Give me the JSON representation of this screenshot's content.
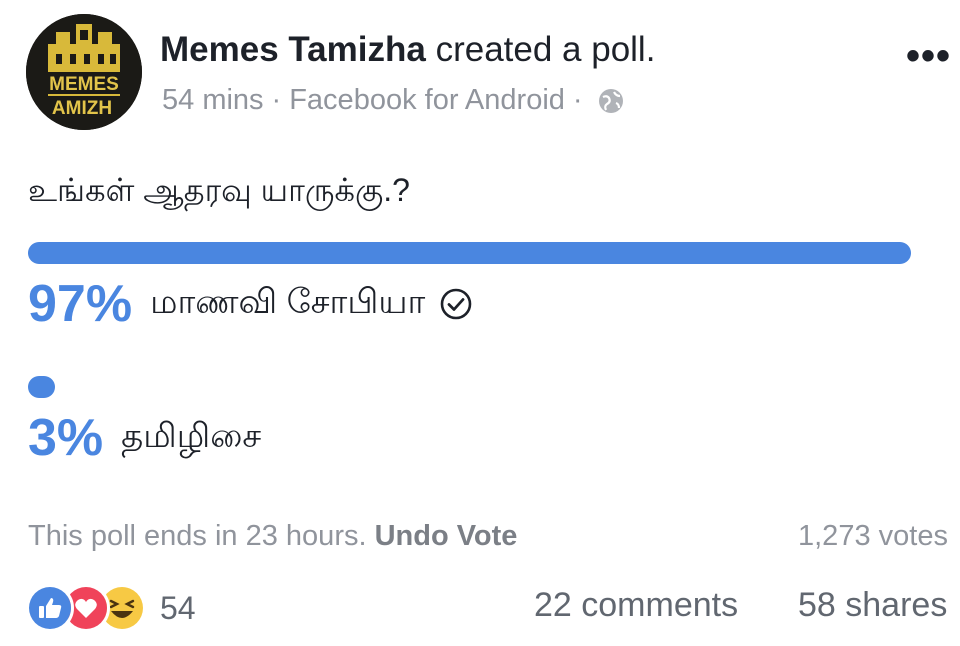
{
  "post": {
    "author": "Memes Tamizha",
    "action": " created a poll.",
    "time": "54 mins",
    "sep1": "·",
    "source": "Facebook for Android",
    "sep2": "·",
    "privacy_icon": "globe-icon",
    "more_icon": "more-options-icon",
    "avatar_text_top": "MEMES",
    "avatar_text_bottom": "AMIZH"
  },
  "poll": {
    "question": "உங்கள் ஆதரவு யாருக்கு.?",
    "options": [
      {
        "percent_label": "97%",
        "percent_value": 97,
        "label": "மாணவி சோபியா",
        "voted": true
      },
      {
        "percent_label": "3%",
        "percent_value": 3,
        "label": "தமிழிசை",
        "voted": false
      }
    ],
    "ends_text": "This poll ends in 23 hours.",
    "undo_label": "Undo Vote",
    "votes_text": "1,273 votes"
  },
  "engagement": {
    "reactions": [
      "like-icon",
      "love-icon",
      "haha-icon"
    ],
    "reaction_count": "54",
    "comments": "22 comments",
    "shares": "58 shares"
  },
  "colors": {
    "accent": "#4a86e0",
    "text": "#1d2129",
    "muted": "#90949c"
  }
}
